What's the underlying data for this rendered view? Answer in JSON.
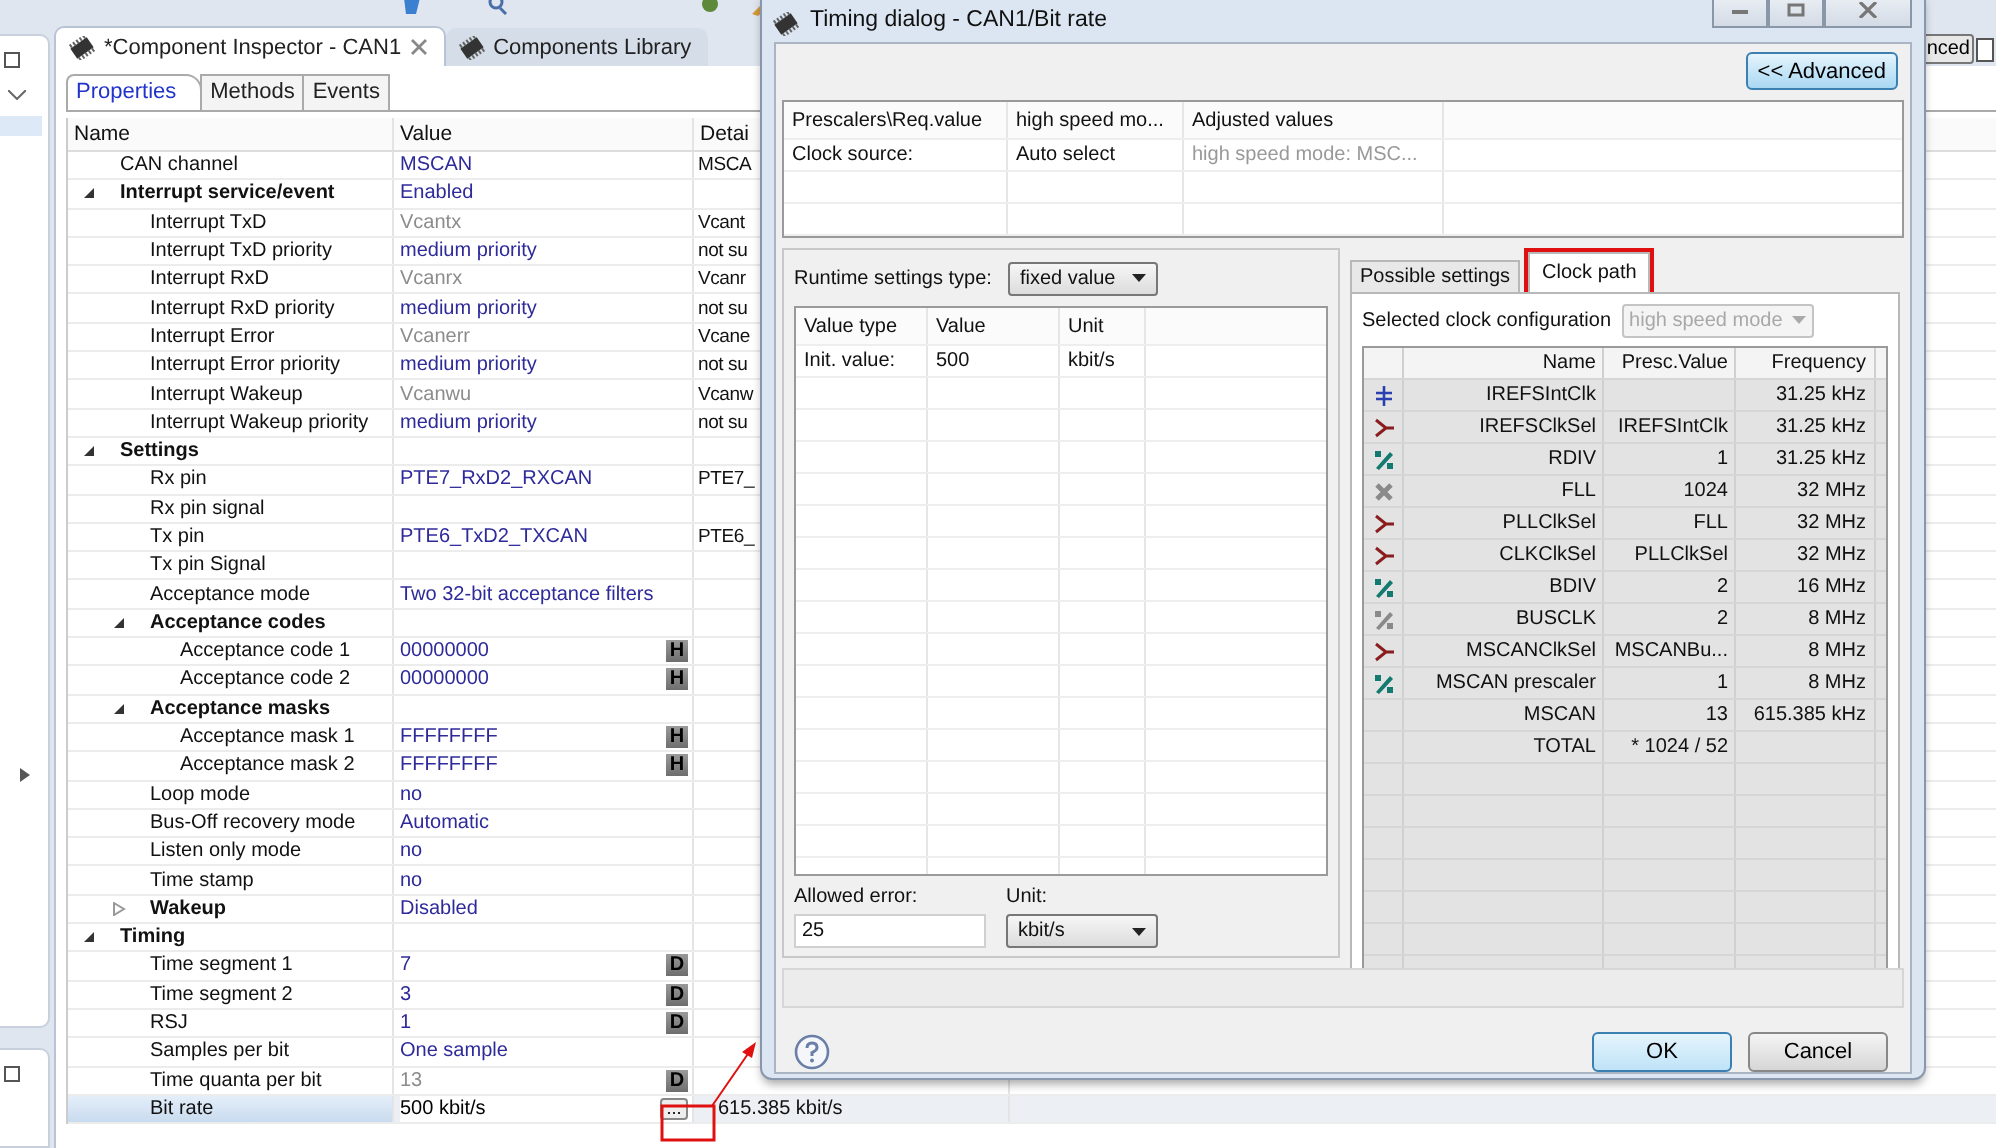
{
  "editor_tabs": [
    {
      "label": "*Component Inspector - CAN1",
      "selected": true,
      "closable": true
    },
    {
      "label": "Components Library",
      "selected": false,
      "closable": false
    }
  ],
  "behind_button": {
    "label": "nced"
  },
  "property_tabs": [
    {
      "label": "Properties",
      "selected": true
    },
    {
      "label": "Methods",
      "selected": false
    },
    {
      "label": "Events",
      "selected": false
    }
  ],
  "properties": {
    "columns": [
      "Name",
      "Value",
      "Detai"
    ],
    "rows": [
      {
        "kind": "property",
        "name": "CAN channel",
        "value": "MSCAN",
        "inactive": false,
        "detail": "MSCA",
        "selected": false
      },
      {
        "kind": "group",
        "name": "Interrupt service/event",
        "value": "Enabled",
        "inactive": false,
        "expanded": true,
        "selected": false,
        "children": [
          {
            "kind": "property",
            "name": "Interrupt TxD",
            "value": "Vcantx",
            "inactive": true,
            "detail": "Vcant",
            "selected": false
          },
          {
            "kind": "property",
            "name": "Interrupt TxD priority",
            "value": "medium priority",
            "inactive": false,
            "detail": "not su",
            "selected": false
          },
          {
            "kind": "property",
            "name": "Interrupt RxD",
            "value": "Vcanrx",
            "inactive": true,
            "detail": "Vcanr",
            "selected": false
          },
          {
            "kind": "property",
            "name": "Interrupt RxD priority",
            "value": "medium priority",
            "inactive": false,
            "detail": "not su",
            "selected": false
          },
          {
            "kind": "property",
            "name": "Interrupt Error",
            "value": "Vcanerr",
            "inactive": true,
            "detail": "Vcane",
            "selected": false
          },
          {
            "kind": "property",
            "name": "Interrupt Error priority",
            "value": "medium priority",
            "inactive": false,
            "detail": "not su",
            "selected": false
          },
          {
            "kind": "property",
            "name": "Interrupt Wakeup",
            "value": "Vcanwu",
            "inactive": true,
            "detail": "Vcanw",
            "selected": false
          },
          {
            "kind": "property",
            "name": "Interrupt Wakeup priority",
            "value": "medium priority",
            "inactive": false,
            "detail": "not su",
            "selected": false
          }
        ]
      },
      {
        "kind": "group",
        "name": "Settings",
        "expanded": true,
        "selected": false,
        "children": [
          {
            "kind": "property",
            "name": "Rx pin",
            "value": "PTE7_RxD2_RXCAN",
            "inactive": false,
            "detail": "PTE7_",
            "selected": false
          },
          {
            "kind": "property",
            "name": "Rx pin signal",
            "selected": false
          },
          {
            "kind": "property",
            "name": "Tx pin",
            "value": "PTE6_TxD2_TXCAN",
            "inactive": false,
            "detail": "PTE6_",
            "selected": false
          },
          {
            "kind": "property",
            "name": "Tx pin Signal",
            "selected": false
          },
          {
            "kind": "property",
            "name": "Acceptance mode",
            "value": "Two 32-bit acceptance filters",
            "inactive": false,
            "selected": false
          },
          {
            "kind": "group",
            "name": "Acceptance codes",
            "expanded": true,
            "selected": false,
            "children": [
              {
                "kind": "property",
                "name": "Acceptance code 1",
                "value": "00000000",
                "inactive": false,
                "badge": "H",
                "selected": false
              },
              {
                "kind": "property",
                "name": "Acceptance code 2",
                "value": "00000000",
                "inactive": false,
                "badge": "H",
                "selected": false
              }
            ]
          },
          {
            "kind": "group",
            "name": "Acceptance masks",
            "expanded": true,
            "selected": false,
            "children": [
              {
                "kind": "property",
                "name": "Acceptance mask 1",
                "value": "FFFFFFFF",
                "inactive": false,
                "badge": "H",
                "selected": false
              },
              {
                "kind": "property",
                "name": "Acceptance mask 2",
                "value": "FFFFFFFF",
                "inactive": false,
                "badge": "H",
                "selected": false
              }
            ]
          },
          {
            "kind": "property",
            "name": "Loop mode",
            "value": "no",
            "inactive": false,
            "selected": false
          },
          {
            "kind": "property",
            "name": "Bus-Off recovery mode",
            "value": "Automatic",
            "inactive": false,
            "selected": false
          },
          {
            "kind": "property",
            "name": "Listen only mode",
            "value": "no",
            "inactive": false,
            "selected": false
          },
          {
            "kind": "property",
            "name": "Time stamp",
            "value": "no",
            "inactive": false,
            "selected": false
          },
          {
            "kind": "group",
            "name": "Wakeup",
            "value": "Disabled",
            "inactive": false,
            "expanded": false,
            "selected": false
          }
        ]
      },
      {
        "kind": "group",
        "name": "Timing",
        "expanded": true,
        "selected": false,
        "children": [
          {
            "kind": "property",
            "name": "Time segment 1",
            "value": "7",
            "inactive": false,
            "badge": "D",
            "selected": false
          },
          {
            "kind": "property",
            "name": "Time segment 2",
            "value": "3",
            "inactive": false,
            "badge": "D",
            "selected": false
          },
          {
            "kind": "property",
            "name": "RSJ",
            "value": "1",
            "inactive": false,
            "badge": "D",
            "selected": false
          },
          {
            "kind": "property",
            "name": "Samples per bit",
            "value": "One sample",
            "inactive": false,
            "selected": false
          },
          {
            "kind": "property",
            "name": "Time quanta per bit",
            "value": "13",
            "inactive": true,
            "badge": "D",
            "selected": false
          },
          {
            "kind": "edit-property",
            "name": "Bit rate",
            "value": "500 kbit/s",
            "action": "...",
            "detail": "615.385 kbit/s",
            "selected": true
          }
        ]
      }
    ]
  },
  "dialog": {
    "title": "Timing dialog - CAN1/Bit rate",
    "advanced_button": "<< Advanced",
    "prescalers": {
      "columns": [
        "Prescalers\\Req.value",
        "high speed mo...",
        "Adjusted values"
      ],
      "rows": [
        {
          "cells": [
            "Clock source:",
            "Auto select",
            "high speed mode: MSC..."
          ]
        }
      ]
    },
    "runtime": {
      "label": "Runtime settings type:",
      "type": "fixed value",
      "columns": [
        "Value type",
        "Value",
        "Unit"
      ],
      "rows": [
        {
          "cells": [
            "Init. value:",
            "500",
            "kbit/s"
          ]
        }
      ],
      "error_label": "Allowed error:",
      "error_value": "25",
      "unit_label": "Unit:",
      "unit": "kbit/s"
    },
    "clock_tabs": [
      {
        "label": "Possible settings",
        "selected": false
      },
      {
        "label": "Clock path",
        "selected": true
      }
    ],
    "clock_config": {
      "label": "Selected clock configuration",
      "value": "high speed mode",
      "disabled": true
    },
    "clock_columns": [
      "Name",
      "Presc.Value",
      "Frequency"
    ],
    "clock_rows": [
      {
        "kind": "oscillator",
        "name": "IREFSIntClk",
        "freq": "31.25 kHz"
      },
      {
        "kind": "selector",
        "name": "IREFSClkSel",
        "presc": "IREFSIntClk",
        "freq": "31.25 kHz"
      },
      {
        "kind": "prescaler",
        "name": "RDIV",
        "presc": "1",
        "freq": "31.25 kHz"
      },
      {
        "kind": "multiplier",
        "name": "FLL",
        "presc": "1024",
        "freq": "32 MHz"
      },
      {
        "kind": "selector",
        "name": "PLLClkSel",
        "presc": "FLL",
        "freq": "32 MHz"
      },
      {
        "kind": "selector",
        "name": "CLKClkSel",
        "presc": "PLLClkSel",
        "freq": "32 MHz"
      },
      {
        "kind": "prescaler",
        "name": "BDIV",
        "presc": "2",
        "freq": "16 MHz"
      },
      {
        "kind": "fixed-divider",
        "name": "BUSCLK",
        "presc": "2",
        "freq": "8 MHz"
      },
      {
        "kind": "selector",
        "name": "MSCANClkSel",
        "presc": "MSCANBu...",
        "freq": "8 MHz"
      },
      {
        "kind": "prescaler",
        "name": "MSCAN prescaler",
        "presc": "1",
        "freq": "8 MHz"
      },
      {
        "kind": "output",
        "name": "MSCAN",
        "presc": "13",
        "freq": "615.385 kHz"
      },
      {
        "kind": "total",
        "name": "TOTAL",
        "presc": "* 1024 / 52"
      }
    ],
    "buttons": [
      {
        "label": "OK",
        "default": true
      },
      {
        "label": "Cancel",
        "default": false
      }
    ]
  }
}
